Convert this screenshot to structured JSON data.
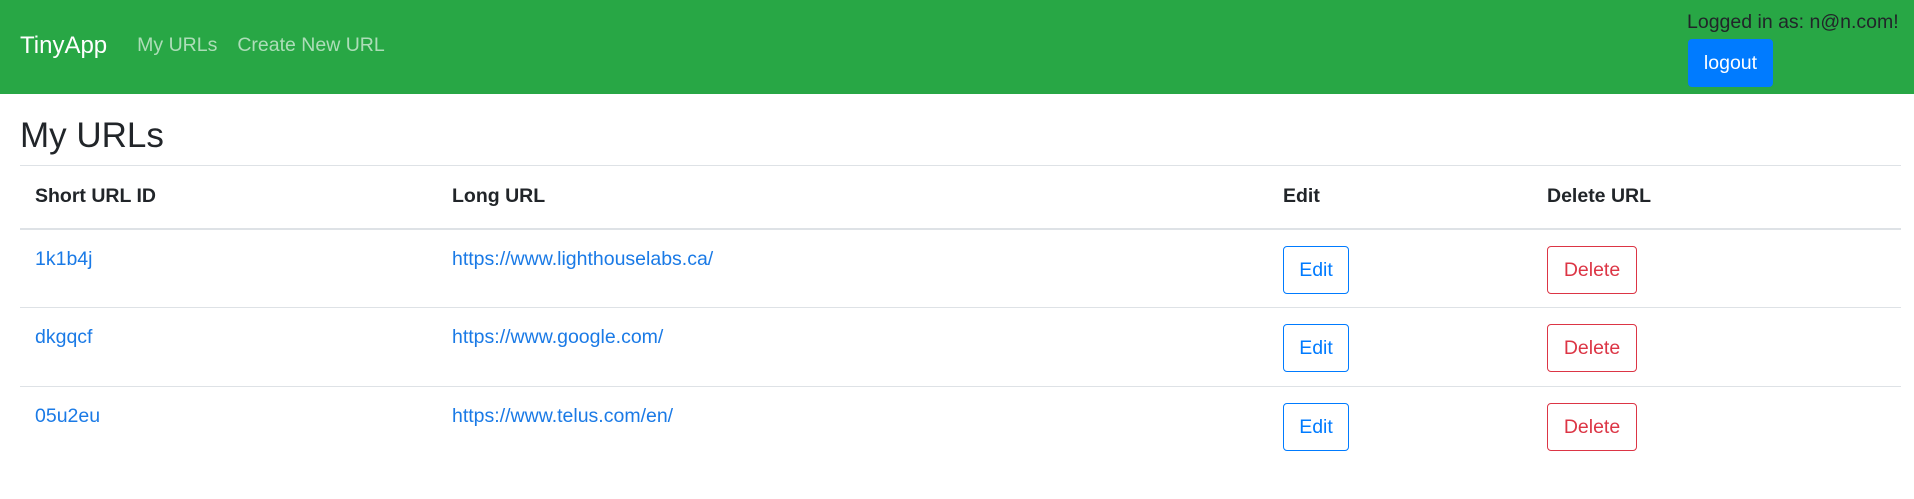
{
  "navbar": {
    "brand": "TinyApp",
    "links": [
      "My URLs",
      "Create New URL"
    ],
    "user_text": "Logged in as: n@n.com!",
    "logout_label": "logout"
  },
  "colors": {
    "navbar_bg": "#28a745",
    "primary": "#007bff",
    "danger": "#dc3545",
    "link": "#1a7ae6"
  },
  "page": {
    "title": "My URLs"
  },
  "table": {
    "headers": [
      "Short URL ID",
      "Long URL",
      "Edit",
      "Delete URL"
    ],
    "rows": [
      {
        "short_id": "1k1b4j",
        "long_url": "https://www.lighthouselabs.ca/",
        "edit_label": "Edit",
        "delete_label": "Delete"
      },
      {
        "short_id": "dkgqcf",
        "long_url": "https://www.google.com/",
        "edit_label": "Edit",
        "delete_label": "Delete"
      },
      {
        "short_id": "05u2eu",
        "long_url": "https://www.telus.com/en/",
        "edit_label": "Edit",
        "delete_label": "Delete"
      }
    ]
  }
}
